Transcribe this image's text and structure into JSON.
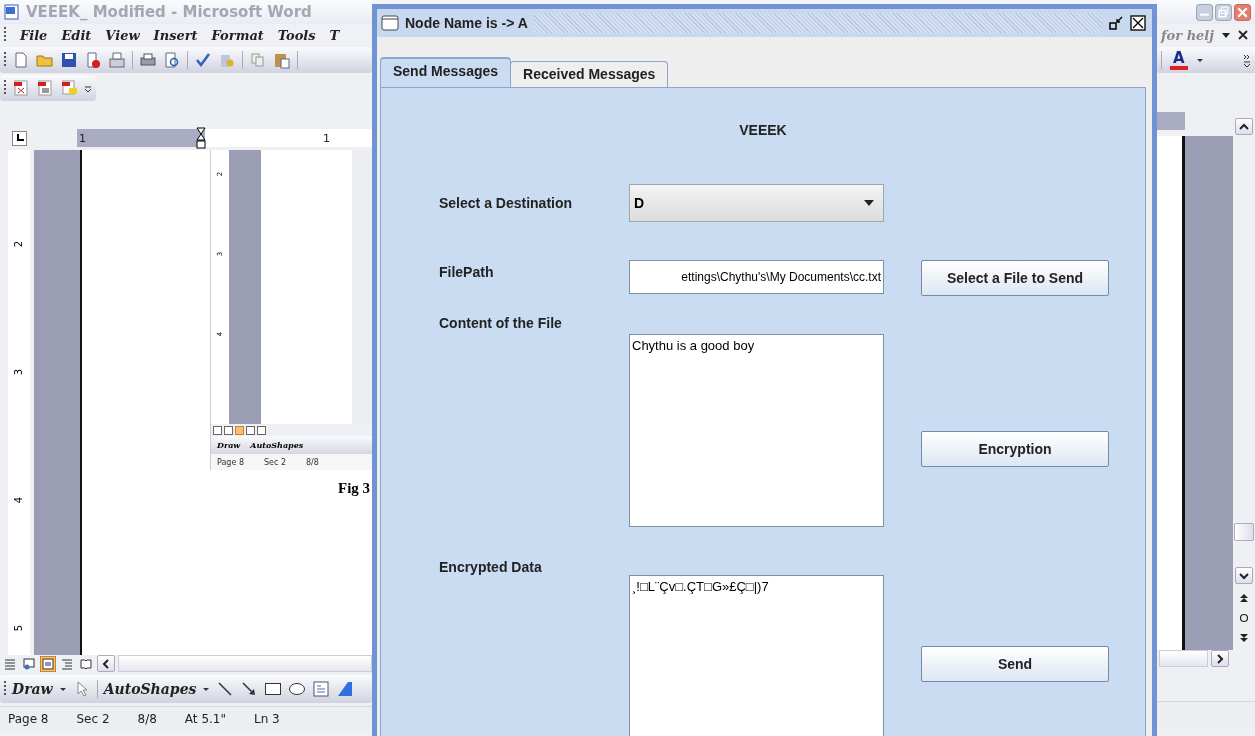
{
  "word": {
    "title": "VEEEK_ Modified - Microsoft Word",
    "menu": [
      "File",
      "Edit",
      "View",
      "Insert",
      "Format",
      "Tools",
      "T"
    ],
    "help_box": "for helj",
    "font_color_label": "A",
    "ruler_numbers": [
      "1",
      "1"
    ],
    "vertical_ruler_numbers": [
      "2",
      "3",
      "4",
      "5"
    ],
    "embedded_screenshot": {
      "vertical_ruler_numbers": [
        "2",
        "3",
        "4"
      ],
      "view_modes": [
        {
          "selected": false
        },
        {
          "selected": false
        },
        {
          "selected": true
        },
        {
          "selected": false
        },
        {
          "selected": false
        }
      ],
      "draw_menu": "Draw",
      "autoshapes_menu": "AutoShapes",
      "status": [
        "Page 8",
        "Sec 2",
        "8/8"
      ]
    },
    "caption": "Fig 3",
    "view_modes": [
      {
        "kind": "normal",
        "selected": false
      },
      {
        "kind": "web",
        "selected": false
      },
      {
        "kind": "print",
        "selected": true
      },
      {
        "kind": "outline",
        "selected": false
      },
      {
        "kind": "reading",
        "selected": false
      }
    ],
    "draw_menu": "Draw",
    "autoshapes_menu": "AutoShapes",
    "status_bar": [
      "Page 8",
      "Sec 2",
      "8/8",
      "At 5.1\"",
      "Ln 3"
    ]
  },
  "dialog": {
    "title": "Node Name  is -> A",
    "tabs": [
      {
        "label": "Send Messages",
        "selected": true
      },
      {
        "label": "Received Messages",
        "selected": false
      }
    ],
    "heading": "VEEEK",
    "destination": {
      "label": "Select a Destination",
      "value": "D"
    },
    "file_path": {
      "label": "FilePath",
      "value": "ettings\\Chythu's\\My Documents\\cc.txt"
    },
    "select_button": "Select a File to Send",
    "content": {
      "label": "Content of the File",
      "value": "Chythu is a good boy"
    },
    "encrypt_button": "Encryption",
    "encrypted": {
      "label": "Encrypted Data",
      "value": "¸!□L¨Çv□.ÇT□G»£Ç□|)7"
    },
    "send_button": "Send"
  }
}
